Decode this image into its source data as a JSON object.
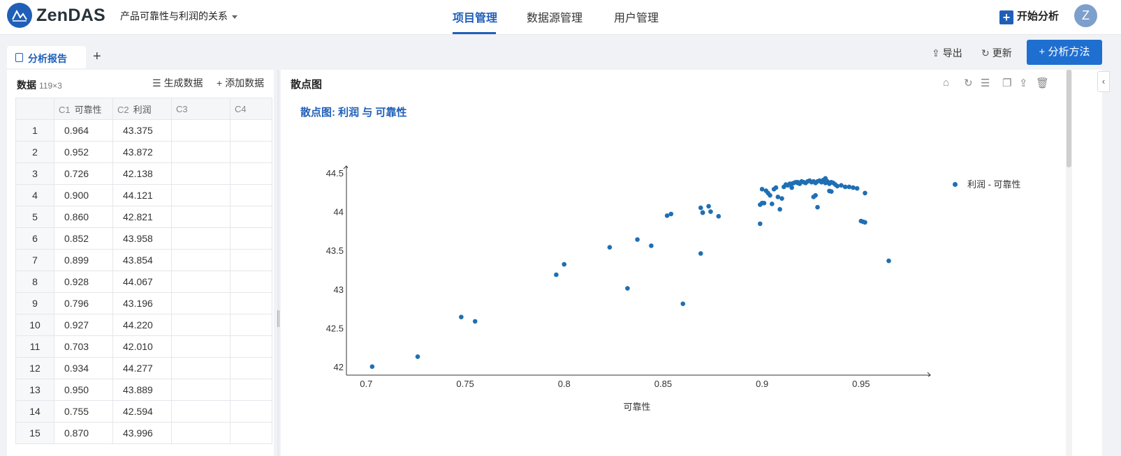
{
  "header": {
    "brand": "ZenDAS",
    "project": "产品可靠性与利润的关系",
    "nav": [
      "项目管理",
      "数据源管理",
      "用户管理"
    ],
    "start_label": "开始分析",
    "avatar_letter": "Z"
  },
  "tabs": {
    "active": "分析报告",
    "add": "+"
  },
  "toolbar": {
    "export": "导出",
    "refresh": "更新",
    "method": "分析方法"
  },
  "data_panel": {
    "title": "数据",
    "dims": "119×3",
    "generate": "生成数据",
    "add": "添加数据",
    "columns": [
      {
        "id": "C1",
        "name": "可靠性"
      },
      {
        "id": "C2",
        "name": "利润"
      },
      {
        "id": "C3",
        "name": ""
      },
      {
        "id": "C4",
        "name": ""
      }
    ],
    "rows": [
      [
        "1",
        "0.964",
        "43.375"
      ],
      [
        "2",
        "0.952",
        "43.872"
      ],
      [
        "3",
        "0.726",
        "42.138"
      ],
      [
        "4",
        "0.900",
        "44.121"
      ],
      [
        "5",
        "0.860",
        "42.821"
      ],
      [
        "6",
        "0.852",
        "43.958"
      ],
      [
        "7",
        "0.899",
        "43.854"
      ],
      [
        "8",
        "0.928",
        "44.067"
      ],
      [
        "9",
        "0.796",
        "43.196"
      ],
      [
        "10",
        "0.927",
        "44.220"
      ],
      [
        "11",
        "0.703",
        "42.010"
      ],
      [
        "12",
        "0.934",
        "44.277"
      ],
      [
        "13",
        "0.950",
        "43.889"
      ],
      [
        "14",
        "0.755",
        "42.594"
      ],
      [
        "15",
        "0.870",
        "43.996"
      ]
    ]
  },
  "chart_panel": {
    "title": "散点图"
  },
  "chart_data": {
    "type": "scatter",
    "title": "散点图: 利润 与 可靠性",
    "xlabel": "可靠性",
    "ylabel": "",
    "xlim": [
      0.69,
      0.985
    ],
    "ylim": [
      41.9,
      44.6
    ],
    "xticks": [
      "0.7",
      "0.75",
      "0.8",
      "0.85",
      "0.9",
      "0.95"
    ],
    "yticks": [
      "42",
      "42.5",
      "43",
      "43.5",
      "44",
      "44.5"
    ],
    "legend": "top-right",
    "color": "#1f6fb4",
    "series": [
      {
        "name": "利润 - 可靠性",
        "points": [
          [
            0.964,
            43.375
          ],
          [
            0.952,
            43.872
          ],
          [
            0.726,
            42.138
          ],
          [
            0.9,
            44.121
          ],
          [
            0.86,
            42.821
          ],
          [
            0.852,
            43.958
          ],
          [
            0.899,
            43.854
          ],
          [
            0.928,
            44.067
          ],
          [
            0.796,
            43.196
          ],
          [
            0.927,
            44.22
          ],
          [
            0.703,
            42.01
          ],
          [
            0.934,
            44.277
          ],
          [
            0.95,
            43.889
          ],
          [
            0.755,
            42.594
          ],
          [
            0.87,
            43.996
          ],
          [
            0.748,
            42.65
          ],
          [
            0.8,
            43.33
          ],
          [
            0.823,
            43.55
          ],
          [
            0.832,
            43.02
          ],
          [
            0.837,
            43.65
          ],
          [
            0.844,
            43.57
          ],
          [
            0.854,
            43.98
          ],
          [
            0.869,
            43.47
          ],
          [
            0.869,
            44.06
          ],
          [
            0.87,
            44.0
          ],
          [
            0.873,
            44.08
          ],
          [
            0.874,
            44.01
          ],
          [
            0.878,
            43.95
          ],
          [
            0.899,
            44.1
          ],
          [
            0.9,
            44.3
          ],
          [
            0.901,
            44.12
          ],
          [
            0.902,
            44.28
          ],
          [
            0.903,
            44.25
          ],
          [
            0.904,
            44.22
          ],
          [
            0.905,
            44.11
          ],
          [
            0.906,
            44.3
          ],
          [
            0.907,
            44.32
          ],
          [
            0.908,
            44.2
          ],
          [
            0.909,
            44.04
          ],
          [
            0.91,
            44.18
          ],
          [
            0.911,
            44.33
          ],
          [
            0.912,
            44.36
          ],
          [
            0.913,
            44.35
          ],
          [
            0.914,
            44.37
          ],
          [
            0.915,
            44.32
          ],
          [
            0.916,
            44.38
          ],
          [
            0.917,
            44.39
          ],
          [
            0.918,
            44.39
          ],
          [
            0.919,
            44.37
          ],
          [
            0.92,
            44.4
          ],
          [
            0.921,
            44.39
          ],
          [
            0.922,
            44.38
          ],
          [
            0.923,
            44.4
          ],
          [
            0.924,
            44.41
          ],
          [
            0.925,
            44.39
          ],
          [
            0.926,
            44.4
          ],
          [
            0.927,
            44.38
          ],
          [
            0.929,
            44.41
          ],
          [
            0.93,
            44.39
          ],
          [
            0.931,
            44.42
          ],
          [
            0.932,
            44.38
          ],
          [
            0.933,
            44.4
          ],
          [
            0.934,
            44.37
          ],
          [
            0.935,
            44.39
          ],
          [
            0.936,
            44.38
          ],
          [
            0.937,
            44.36
          ],
          [
            0.938,
            44.34
          ],
          [
            0.94,
            44.35
          ],
          [
            0.942,
            44.33
          ],
          [
            0.944,
            44.33
          ],
          [
            0.946,
            44.32
          ],
          [
            0.948,
            44.31
          ],
          [
            0.952,
            44.25
          ],
          [
            0.951,
            43.88
          ],
          [
            0.926,
            44.2
          ],
          [
            0.935,
            44.27
          ],
          [
            0.915,
            44.37
          ],
          [
            0.918,
            44.38
          ],
          [
            0.928,
            44.4
          ],
          [
            0.932,
            44.44
          ]
        ]
      }
    ]
  }
}
